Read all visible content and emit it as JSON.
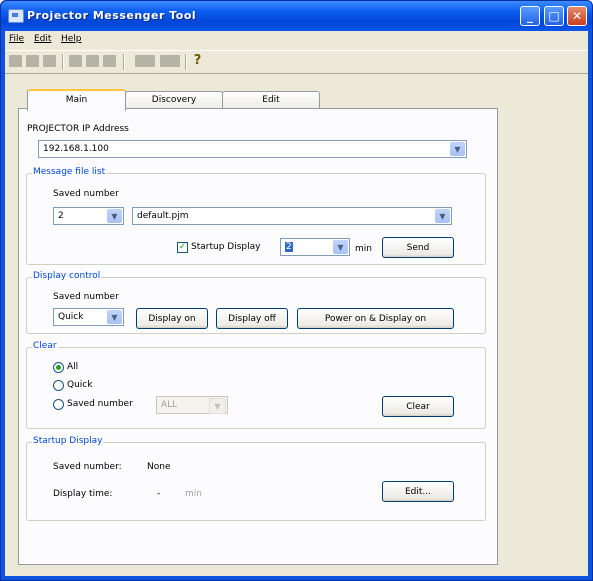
{
  "window": {
    "title": "Projector Messenger Tool"
  },
  "menu": [
    "File",
    "Edit",
    "Help"
  ],
  "toolbar": {
    "help_icon": "help-icon"
  },
  "tabs": [
    "Main",
    "Discovery",
    "Edit"
  ],
  "main": {
    "ip_label": "PROJECTOR IP Address",
    "ip_value": "192.168.1.100",
    "message_file": {
      "title": "Message file list",
      "saved_number_label": "Saved number",
      "saved_number_value": "2",
      "file_value": "default.pjm",
      "startup_display_label": "Startup Display",
      "startup_checked": true,
      "minutes_value": "2",
      "min_label": "min",
      "send_label": "Send"
    },
    "display_control": {
      "title": "Display control",
      "saved_number_label": "Saved number",
      "saved_number_value": "Quick",
      "display_on_label": "Display on",
      "display_off_label": "Display off",
      "power_on_label": "Power on & Display on"
    },
    "clear": {
      "title": "Clear",
      "options": [
        "All",
        "Quick",
        "Saved number"
      ],
      "selected": "All",
      "saved_number_value": "ALL",
      "clear_label": "Clear"
    },
    "startup_display": {
      "title": "Startup Display",
      "saved_number_label": "Saved number:",
      "saved_number_value": "None",
      "display_time_label": "Display time:",
      "display_time_value": "-",
      "min_label": "min",
      "edit_label": "Edit..."
    }
  }
}
